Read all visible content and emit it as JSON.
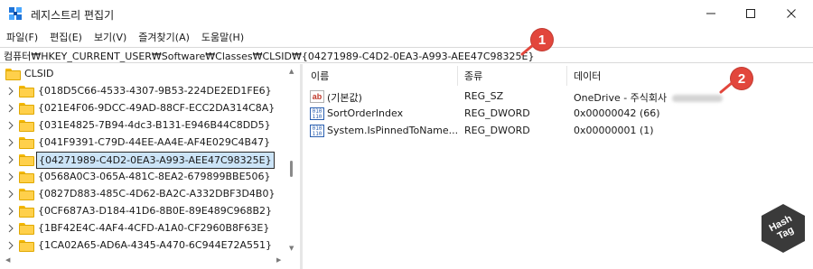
{
  "window": {
    "title": "레지스트리 편집기",
    "icon": "regedit-icon"
  },
  "menu": [
    "파일(F)",
    "편집(E)",
    "보기(V)",
    "즐겨찾기(A)",
    "도움말(H)"
  ],
  "address": {
    "path": "컴퓨터₩HKEY_CURRENT_USER₩Software₩Classes₩CLSID₩{04271989-C4D2-0EA3-A993-AEE47C98325E}"
  },
  "badges": [
    "1",
    "2"
  ],
  "tree": {
    "root": "CLSID",
    "items": [
      "{018D5C66-4533-4307-9B53-224DE2ED1FE6}",
      "{021E4F06-9DCC-49AD-88CF-ECC2DA314C8A}",
      "{031E4825-7B94-4dc3-B131-E946B44C8DD5}",
      "{041F9391-C79D-44EE-AA4E-AF4E029C4B47}",
      "{04271989-C4D2-0EA3-A993-AEE47C98325E}",
      "{0568A0C3-065A-481C-8EA2-679899BBE506}",
      "{0827D883-485C-4D62-BA2C-A332DBF3D4B0}",
      "{0CF687A3-D184-41D6-8B0E-89E489C968B2}",
      "{1BF42E4C-4AF4-4CFD-A1A0-CF2960B8F63E}",
      "{1CA02A65-AD6A-4345-A470-6C944E72A551}"
    ],
    "selected_index": 4
  },
  "columns": [
    "이름",
    "종류",
    "데이터"
  ],
  "values": [
    {
      "icon": "string-value-icon",
      "name": "(기본값)",
      "type": "REG_SZ",
      "data": "OneDrive - 주식회사",
      "data_redacted": true
    },
    {
      "icon": "dword-value-icon",
      "name": "SortOrderIndex",
      "type": "REG_DWORD",
      "data": "0x00000042 (66)"
    },
    {
      "icon": "dword-value-icon",
      "name": "System.IsPinnedToName...",
      "type": "REG_DWORD",
      "data": "0x00000001 (1)"
    }
  ],
  "watermark": {
    "line1": "Hash",
    "line2": "Tag",
    "color": "#3a3a3a"
  },
  "colors": {
    "badge": "#e2463c",
    "selection": "#cce4f7",
    "folder": "#ffd04b"
  }
}
